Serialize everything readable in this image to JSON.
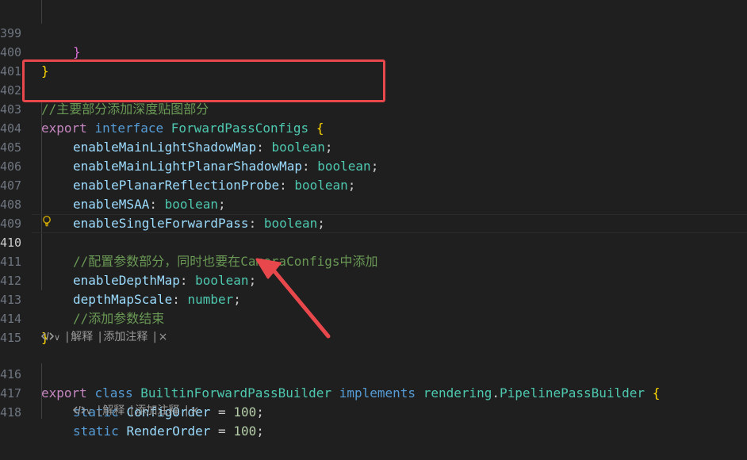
{
  "colors": {
    "background": "#1f1f1f",
    "highlight_box": "#e8474c",
    "annotation_arrow": "#e8474c",
    "keyword": "#569cd6",
    "control_keyword": "#c586c0",
    "type": "#4ec9b0",
    "property": "#9cdcfe",
    "comment": "#6a9955",
    "number": "#b5cea8"
  },
  "lines": [
    {
      "n": "399",
      "text": "}"
    },
    {
      "n": "400",
      "text": "}"
    },
    {
      "n": "401",
      "text": ""
    },
    {
      "n": "402",
      "text": "//主要部分添加深度贴图部分"
    },
    {
      "n": "403",
      "kw": "export",
      "kw2": "interface",
      "name": "ForwardPassConfigs",
      "brace": "{"
    },
    {
      "n": "404",
      "prop": "enableMainLightShadowMap",
      "type": "boolean"
    },
    {
      "n": "405",
      "prop": "enableMainLightPlanarShadowMap",
      "type": "boolean"
    },
    {
      "n": "406",
      "prop": "enablePlanarReflectionProbe",
      "type": "boolean"
    },
    {
      "n": "407",
      "prop": "enableMSAA",
      "type": "boolean"
    },
    {
      "n": "408",
      "prop": "enableSingleForwardPass",
      "type": "boolean"
    },
    {
      "n": "409",
      "text": ""
    },
    {
      "n": "410",
      "text": "//配置参数部分，同时也要在CameraConfigs中添加"
    },
    {
      "n": "411",
      "prop": "enableDepthMap",
      "type": "boolean"
    },
    {
      "n": "412",
      "prop": "depthMapScale",
      "type": "number"
    },
    {
      "n": "413",
      "text": "//添加参数结束"
    },
    {
      "n": "414",
      "text": "}"
    },
    {
      "n": "415",
      "text": ""
    },
    {
      "n": "416",
      "kw": "export",
      "kw2": "class",
      "name": "BuiltinForwardPassBuilder",
      "kw3": "implements",
      "ns": "rendering",
      "iface": "PipelinePassBuilder",
      "brace": "{"
    },
    {
      "n": "417",
      "kw": "static",
      "name": "ConfigOrder",
      "op": "=",
      "num": "100"
    },
    {
      "n": "418",
      "kw": "static",
      "name": "RenderOrder",
      "op": "=",
      "num": "100"
    }
  ],
  "codelens": {
    "explain": "解释",
    "add_comment": "添加注释",
    "close": "×",
    "sep": "|"
  }
}
